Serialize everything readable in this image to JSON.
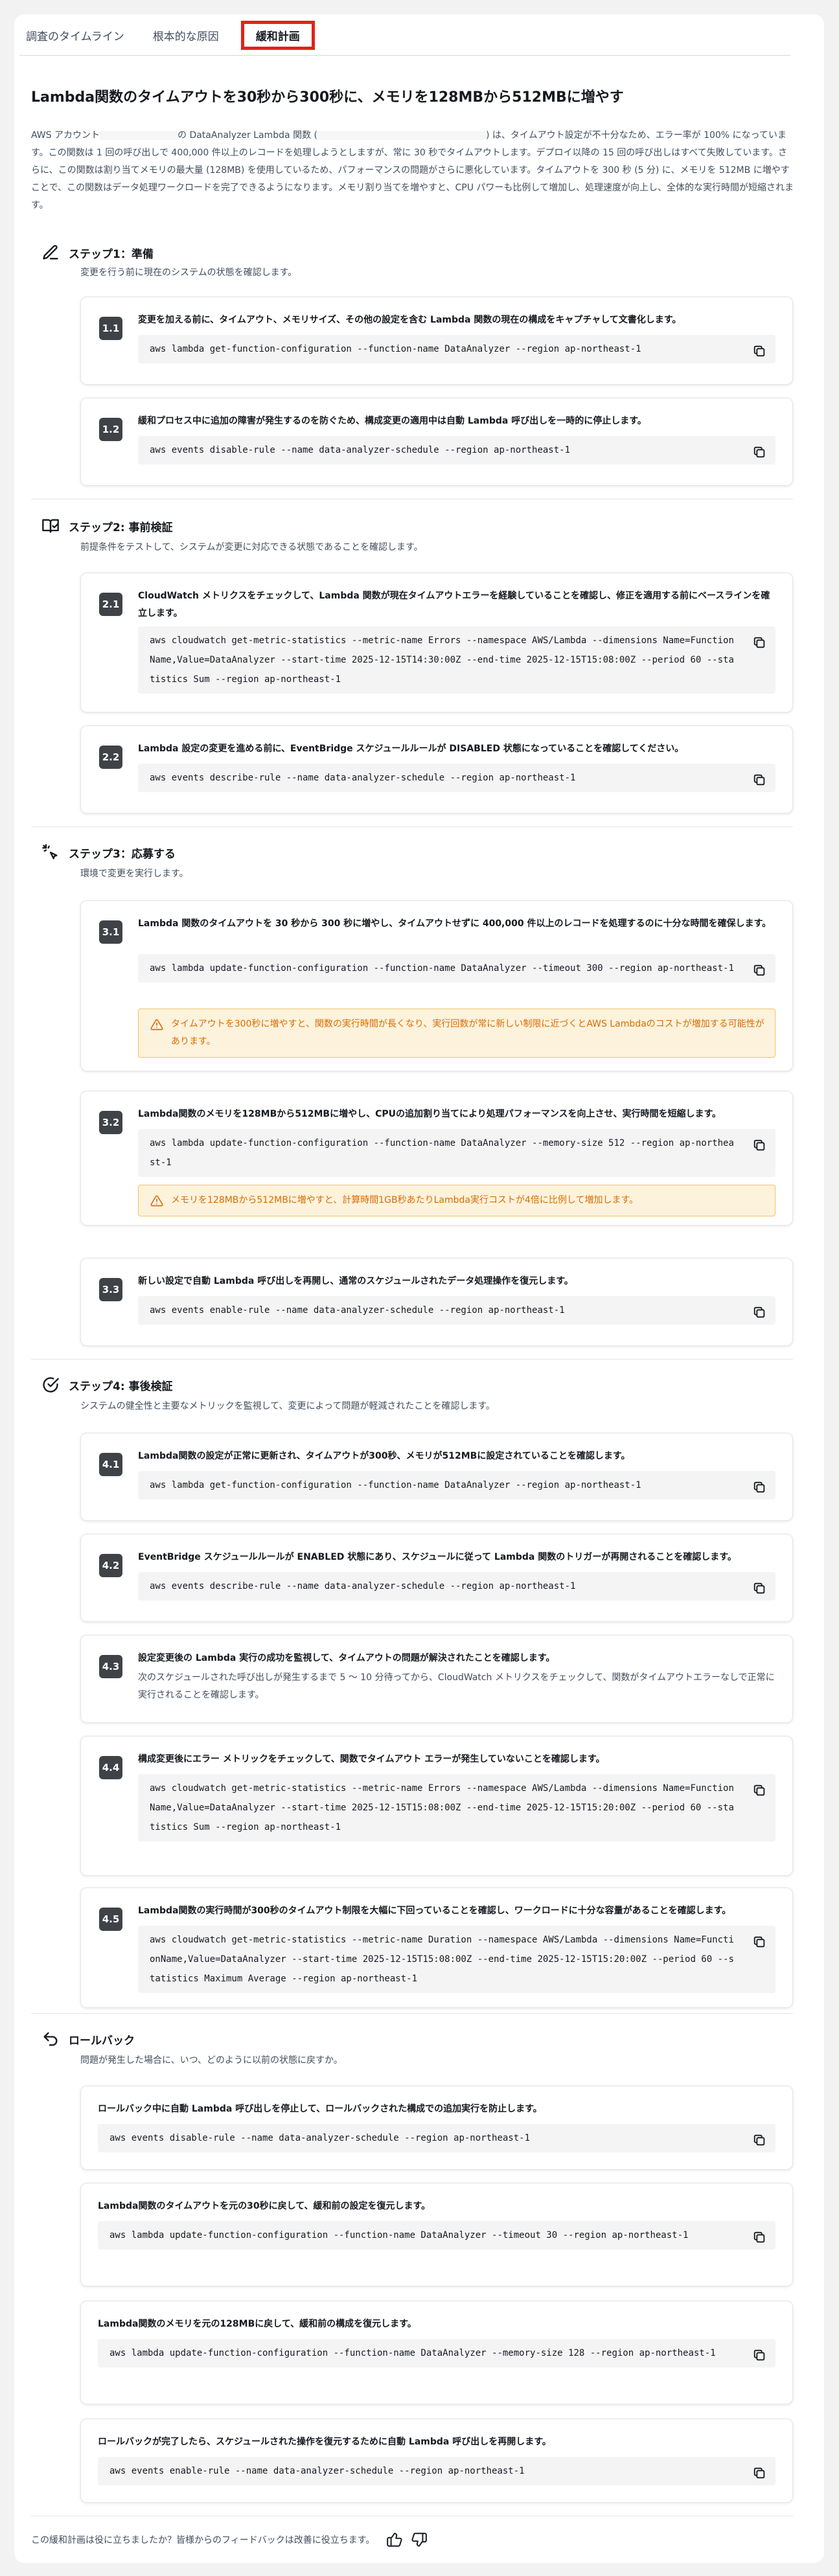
{
  "tabs": [
    "調査のタイムライン",
    "根本的な原因",
    "緩和計画"
  ],
  "title": "Lambda関数のタイムアウトを30秒から300秒に、メモリを128MBから512MBに増やす",
  "intro": {
    "part1": "AWS アカウント",
    "part2": "の DataAnalyzer Lambda 関数 (",
    "part3": ") は、タイムアウト設定が不十分なため、エラー率が 100% になっています。この関数は 1 回の呼び出しで 400,000 件以上のレコードを処理しようとしますが、常に 30 秒でタイムアウトします。デプロイ以降の 15 回の呼び出しはすべて失敗しています。さらに、この関数は割り当てメモリの最大量 (128MB) を使用しているため、パフォーマンスの問題がさらに悪化しています。タイムアウトを 300 秒 (5 分) に、メモリを 512MB に増やすことで、この関数はデータ処理ワークロードを完了できるようになります。メモリ割り当てを増やすと、CPU パワーも比例して増加し、処理速度が向上し、全体的な実行時間が短縮されます。"
  },
  "sections": [
    {
      "title": "ステップ1：準備",
      "desc": "変更を行う前に現在のシステムの状態を確認します。",
      "icon": "pencil-icon",
      "steps": [
        {
          "num": "1.1",
          "text": "変更を加える前に、タイムアウト、メモリサイズ、その他の設定を含む Lambda 関数の現在の構成をキャプチャして文書化します。",
          "code": "aws lambda get-function-configuration --function-name DataAnalyzer --region ap-northeast-1"
        },
        {
          "num": "1.2",
          "text": "緩和プロセス中に追加の障害が発生するのを防ぐため、構成変更の適用中は自動 Lambda 呼び出しを一時的に停止します。",
          "code": "aws events disable-rule --name data-analyzer-schedule --region ap-northeast-1"
        }
      ]
    },
    {
      "title": "ステップ2: 事前検証",
      "desc": "前提条件をテストして、システムが変更に対応できる状態であることを確認します。",
      "icon": "book-check-icon",
      "steps": [
        {
          "num": "2.1",
          "text": "CloudWatch メトリクスをチェックして、Lambda 関数が現在タイムアウトエラーを経験していることを確認し、修正を適用する前にベースラインを確立します。",
          "code": "aws cloudwatch get-metric-statistics --metric-name Errors --namespace AWS/Lambda --dimensions Name=FunctionName,Value=DataAnalyzer --start-time 2025-12-15T14:30:00Z --end-time 2025-12-15T15:08:00Z --period 60 --statistics Sum --region ap-northeast-1"
        },
        {
          "num": "2.2",
          "text": "Lambda 設定の変更を進める前に、EventBridge スケジュールルールが DISABLED 状態になっていることを確認してください。",
          "code": "aws events describe-rule --name data-analyzer-schedule --region ap-northeast-1"
        }
      ]
    },
    {
      "title": "ステップ3：応募する",
      "desc": "環境で変更を実行します。",
      "icon": "sparkle-pointer-icon",
      "steps": [
        {
          "num": "3.1",
          "text": "Lambda 関数のタイムアウトを 30 秒から 300 秒に増やし、タイムアウトせずに 400,000 件以上のレコードを処理するのに十分な時間を確保します。",
          "code": "aws lambda update-function-configuration --function-name DataAnalyzer --timeout 300 --region ap-northeast-1",
          "warn": "タイムアウトを300秒に増やすと、関数の実行時間が長くなり、実行回数が常に新しい制限に近づくとAWS Lambdaのコストが増加する可能性があります。"
        },
        {
          "num": "3.2",
          "text": "Lambda関数のメモリを128MBから512MBに増やし、CPUの追加割り当てにより処理パフォーマンスを向上させ、実行時間を短縮します。",
          "code": "aws lambda update-function-configuration --function-name DataAnalyzer --memory-size 512 --region ap-northeast-1",
          "warn": "メモリを128MBから512MBに増やすと、計算時間1GB秒あたりLambda実行コストが4倍に比例して増加します。"
        },
        {
          "num": "3.3",
          "text": "新しい設定で自動 Lambda 呼び出しを再開し、通常のスケジュールされたデータ処理操作を復元します。",
          "code": "aws events enable-rule --name data-analyzer-schedule --region ap-northeast-1"
        }
      ]
    },
    {
      "title": "ステップ4: 事後検証",
      "desc": "システムの健全性と主要なメトリックを監視して、変更によって問題が軽減されたことを確認します。",
      "icon": "check-circle-icon",
      "steps": [
        {
          "num": "4.1",
          "text": "Lambda関数の設定が正常に更新され、タイムアウトが300秒、メモリが512MBに設定されていることを確認します。",
          "code": "aws lambda get-function-configuration --function-name DataAnalyzer --region ap-northeast-1"
        },
        {
          "num": "4.2",
          "text": "EventBridge スケジュールルールが ENABLED 状態にあり、スケジュールに従って Lambda 関数のトリガーが再開されることを確認します。",
          "code": "aws events describe-rule --name data-analyzer-schedule --region ap-northeast-1"
        },
        {
          "num": "4.3",
          "text": "設定変更後の Lambda 実行の成功を監視して、タイムアウトの問題が解決されたことを確認します。",
          "sub": "次のスケジュールされた呼び出しが発生するまで 5 ～ 10 分待ってから、CloudWatch メトリクスをチェックして、関数がタイムアウトエラーなしで正常に実行されることを確認します。"
        },
        {
          "num": "4.4",
          "text": "構成変更後にエラー メトリックをチェックして、関数でタイムアウト エラーが発生していないことを確認します。",
          "code": "aws cloudwatch get-metric-statistics --metric-name Errors --namespace AWS/Lambda --dimensions Name=FunctionName,Value=DataAnalyzer --start-time 2025-12-15T15:08:00Z --end-time 2025-12-15T15:20:00Z --period 60 --statistics Sum --region ap-northeast-1"
        },
        {
          "num": "4.5",
          "text": "Lambda関数の実行時間が300秒のタイムアウト制限を大幅に下回っていることを確認し、ワークロードに十分な容量があることを確認します。",
          "code": "aws cloudwatch get-metric-statistics --metric-name Duration --namespace AWS/Lambda --dimensions Name=FunctionName,Value=DataAnalyzer --start-time 2025-12-15T15:08:00Z --end-time 2025-12-15T15:20:00Z --period 60 --statistics Maximum Average --region ap-northeast-1"
        }
      ]
    }
  ],
  "rollback": {
    "title": "ロールバック",
    "desc": "問題が発生した場合に、いつ、どのように以前の状態に戻すか。",
    "icon": "undo-icon",
    "steps": [
      {
        "text": "ロールバック中に自動 Lambda 呼び出しを停止して、ロールバックされた構成での追加実行を防止します。",
        "code": "aws events disable-rule --name data-analyzer-schedule --region ap-northeast-1"
      },
      {
        "text": "Lambda関数のタイムアウトを元の30秒に戻して、緩和前の設定を復元します。",
        "code": "aws lambda update-function-configuration --function-name DataAnalyzer --timeout 30 --region ap-northeast-1"
      },
      {
        "text": "Lambda関数のメモリを元の128MBに戻して、緩和前の構成を復元します。",
        "code": "aws lambda update-function-configuration --function-name DataAnalyzer --memory-size 128 --region ap-northeast-1"
      },
      {
        "text": "ロールバックが完了したら、スケジュールされた操作を復元するために自動 Lambda 呼び出しを再開します。",
        "code": "aws events enable-rule --name data-analyzer-schedule --region ap-northeast-1"
      }
    ]
  },
  "feedback": "この緩和計画は役に立ちましたか？皆様からのフィードバックは改善に役立ちます。"
}
